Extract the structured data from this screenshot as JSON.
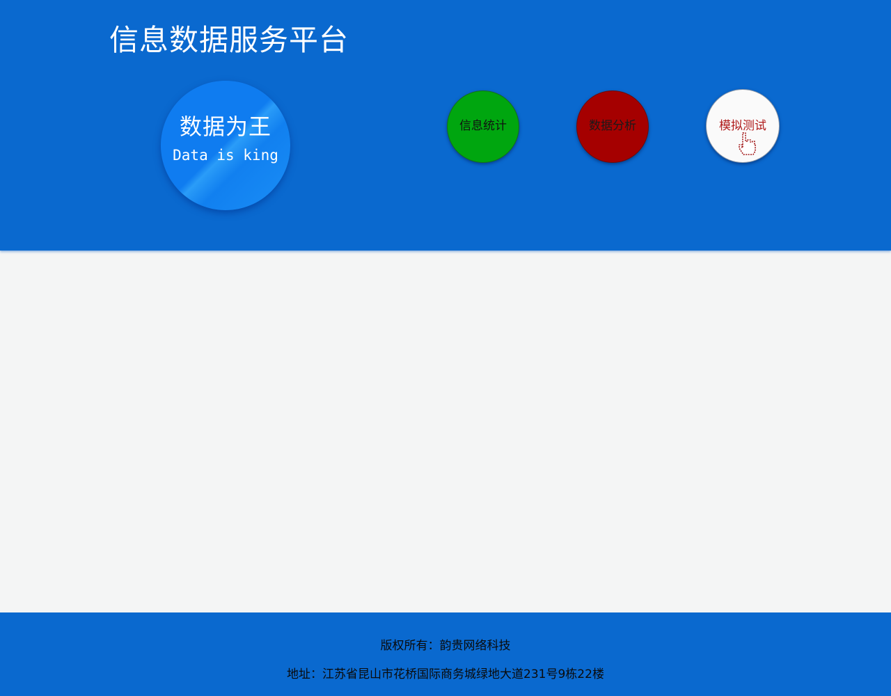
{
  "header": {
    "title": "信息数据服务平台",
    "background_color": "#0a69cf"
  },
  "badge": {
    "title": "数据为王",
    "subtitle": "Data is king"
  },
  "nav": [
    {
      "label": "信息统计",
      "color": "#00a60f"
    },
    {
      "label": "数据分析",
      "color": "#a50000"
    },
    {
      "label": "模拟测试",
      "color": "#fafafa",
      "icon": "hand-pointer-icon"
    }
  ],
  "footer": {
    "copyright": "版权所有：韵贵网络科技",
    "address": "地址：江苏省昆山市花桥国际商务城绿地大道231号9栋22楼"
  }
}
